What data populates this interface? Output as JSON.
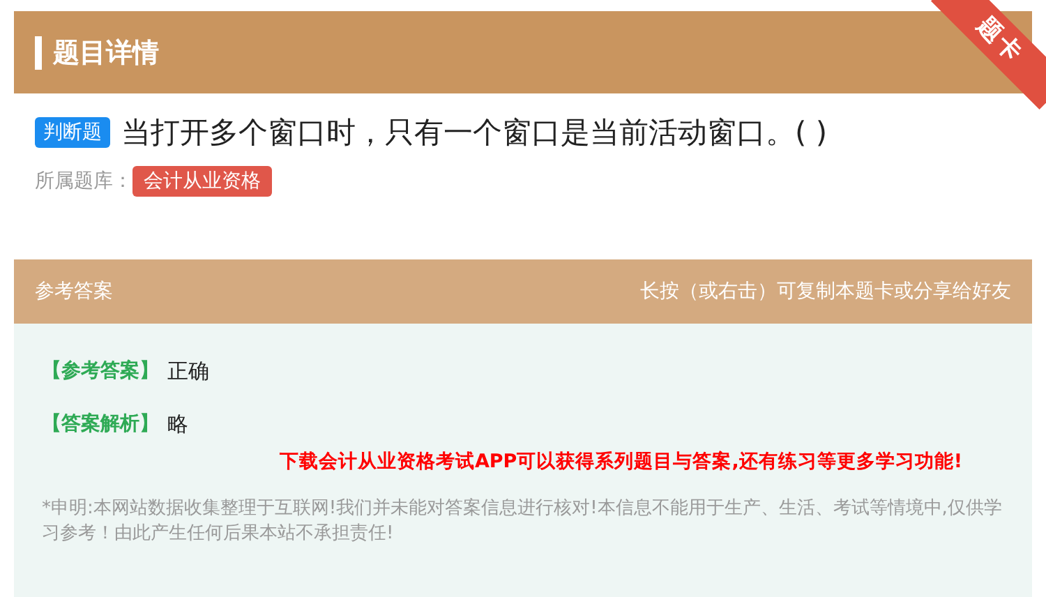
{
  "header": {
    "title": "题目详情",
    "corner_badge": "题卡"
  },
  "question": {
    "type_tag": "判断题",
    "text": "当打开多个窗口时，只有一个窗口是当前活动窗口。( )",
    "bank_label": "所属题库：",
    "bank_tag": "会计从业资格"
  },
  "answer_bar": {
    "title": "参考答案",
    "hint": "长按（或右击）可复制本题卡或分享给好友"
  },
  "answer": {
    "answer_label": "【参考答案】",
    "answer_value": "正确",
    "analysis_label": "【答案解析】",
    "analysis_value": "略",
    "promo": "下载会计从业资格考试APP可以获得系列题目与答案,还有练习等更多学习功能!",
    "disclaimer": "*申明:本网站数据收集整理于互联网!我们并未能对答案信息进行核对!本信息不能用于生产、生活、考试等情境中,仅供学习参考！由此产生任何后果本站不承担责任!"
  }
}
